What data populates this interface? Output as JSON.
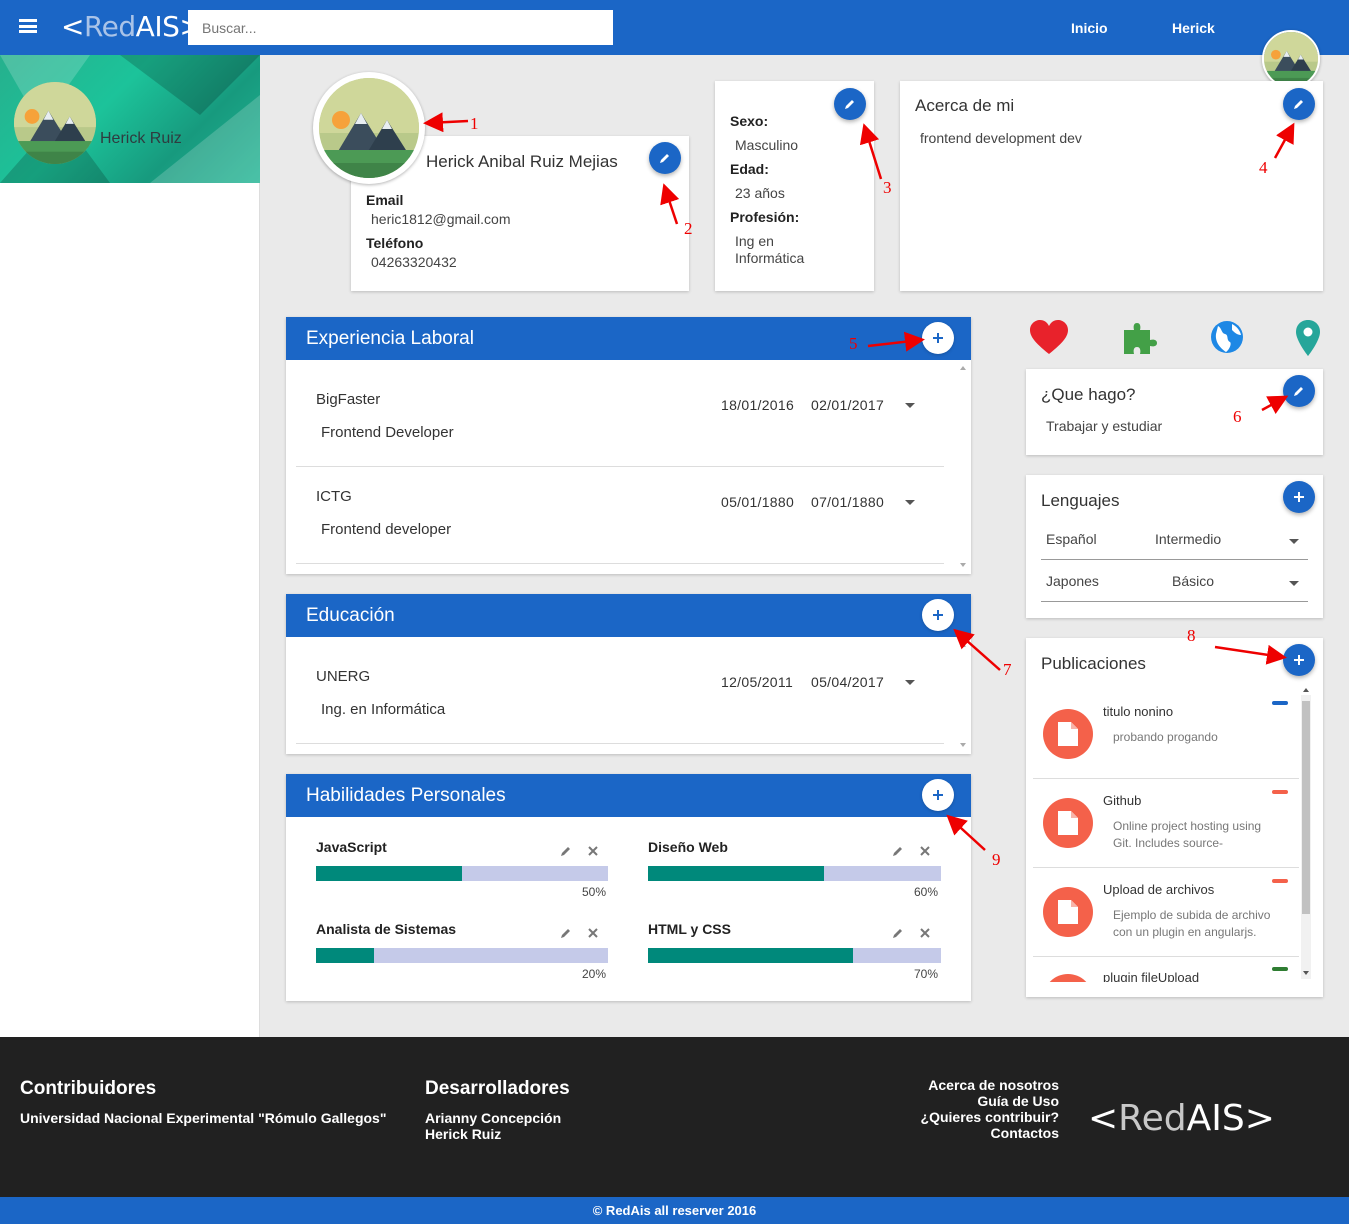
{
  "header": {
    "brand_open": "<",
    "brand_red": "Red",
    "brand_ais": "AIS",
    "brand_close": ">",
    "search_placeholder": "Buscar...",
    "nav_home": "Inicio",
    "nav_user": "Herick"
  },
  "sidebar": {
    "user_name": "Herick Ruiz"
  },
  "profile": {
    "full_name": "Herick Anibal Ruiz Mejias",
    "email_label": "Email",
    "email": "heric1812@gmail.com",
    "phone_label": "Teléfono",
    "phone": "04263320432"
  },
  "details": {
    "sex_label": "Sexo:",
    "sex": "Masculino",
    "age_label": "Edad:",
    "age": "23 años",
    "profession_label": "Profesión:",
    "profession_line1": "Ing en",
    "profession_line2": "Informática"
  },
  "about": {
    "title": "Acerca de mi",
    "text": "frontend development dev"
  },
  "experience": {
    "title": "Experiencia Laboral",
    "items": [
      {
        "company": "BigFaster",
        "role": "Frontend Developer",
        "start": "18/01/2016",
        "end": "02/01/2017"
      },
      {
        "company": "ICTG",
        "role": "Frontend developer",
        "start": "05/01/1880",
        "end": "07/01/1880"
      }
    ]
  },
  "education": {
    "title": "Educación",
    "items": [
      {
        "school": "UNERG",
        "degree": "Ing. en Informática",
        "start": "12/05/2011",
        "end": "05/04/2017"
      }
    ]
  },
  "skills": {
    "title": "Habilidades Personales",
    "items": [
      {
        "name": "JavaScript",
        "percent": 50,
        "label": "50%"
      },
      {
        "name": "Diseño Web",
        "percent": 60,
        "label": "60%"
      },
      {
        "name": "Analista de Sistemas",
        "percent": 20,
        "label": "20%"
      },
      {
        "name": "HTML y CSS",
        "percent": 70,
        "label": "70%"
      }
    ]
  },
  "icons_row": [
    "heart-icon",
    "puzzle-icon",
    "globe-icon",
    "location-pin-icon"
  ],
  "what_i_do": {
    "title": "¿Que hago?",
    "text": "Trabajar y estudiar"
  },
  "languages": {
    "title": "Lenguajes",
    "items": [
      {
        "language": "Español",
        "level": "Intermedio"
      },
      {
        "language": "Japones",
        "level": "Básico"
      }
    ]
  },
  "publications": {
    "title": "Publicaciones",
    "items": [
      {
        "title": "titulo nonino",
        "desc": "probando progando",
        "tag_color": "#1b66c6"
      },
      {
        "title": "Github",
        "desc": "Online project hosting using Git. Includes source-",
        "tag_color": "#f4614a"
      },
      {
        "title": "Upload de archivos",
        "desc": "Ejemplo de subida de archivo con un plugin en angularjs.",
        "tag_color": "#f4614a"
      },
      {
        "title": "plugin fileUpload",
        "desc": "",
        "tag_color": "#2e7d32"
      }
    ]
  },
  "annotations": [
    "1",
    "2",
    "3",
    "4",
    "5",
    "6",
    "7",
    "8",
    "9"
  ],
  "footer": {
    "contrib_title": "Contribuidores",
    "contrib_text": "Universidad Nacional Experimental \"Rómulo Gallegos\"",
    "dev_title": "Desarrolladores",
    "dev_1": "Arianny Concepción",
    "dev_2": "Herick Ruiz",
    "link_about": "Acerca de nosotros",
    "link_guide": "Guía de Uso",
    "link_contribute": "¿Quieres contribuir?",
    "link_contacts": "Contactos",
    "copyright": "© RedAis all reserver 2016"
  }
}
